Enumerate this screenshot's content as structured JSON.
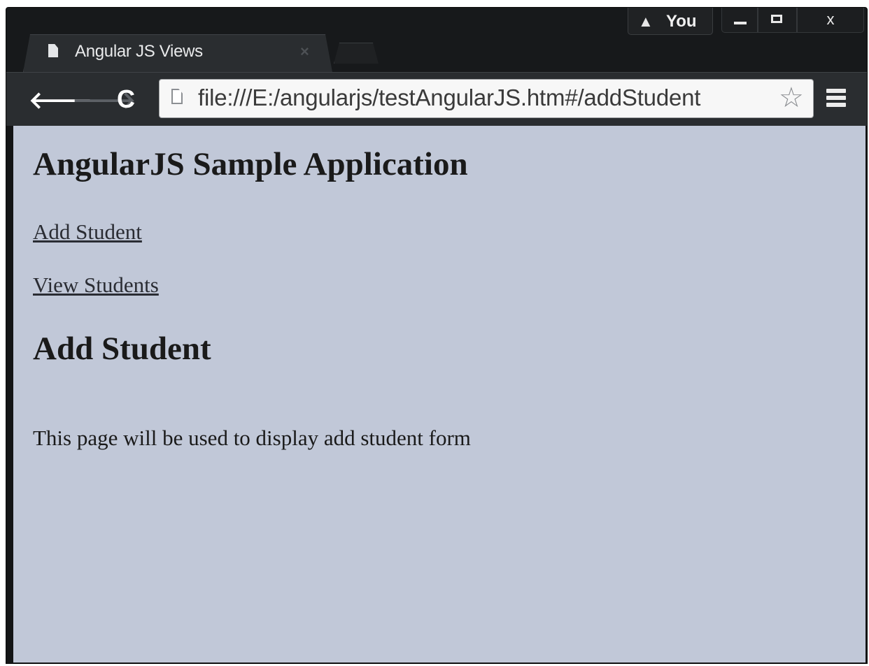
{
  "tab": {
    "title": "Angular JS Views",
    "close_glyph": "×"
  },
  "profile": {
    "name": "You",
    "warning_glyph": "▲"
  },
  "window_controls": {
    "close_glyph": "x"
  },
  "toolbar": {
    "back_glyph": "🡐",
    "forward_glyph": "🡒",
    "reload_glyph": "C",
    "url": "file:///E:/angularjs/testAngularJS.htm#/addStudent",
    "star_glyph": "☆"
  },
  "page": {
    "heading": "AngularJS Sample Application",
    "links": [
      {
        "label": "Add Student"
      },
      {
        "label": "View Students"
      }
    ],
    "subheading": "Add Student",
    "paragraph": "This page will be used to display add student form"
  },
  "colors": {
    "chrome_dark": "#17191b",
    "toolbar": "#2a2d30",
    "page_background": "#c1c8d8"
  },
  "icons": [
    "document-icon",
    "warning-icon",
    "back-arrow-icon",
    "forward-arrow-icon",
    "reload-icon",
    "page-icon",
    "star-icon",
    "menu-icon"
  ]
}
